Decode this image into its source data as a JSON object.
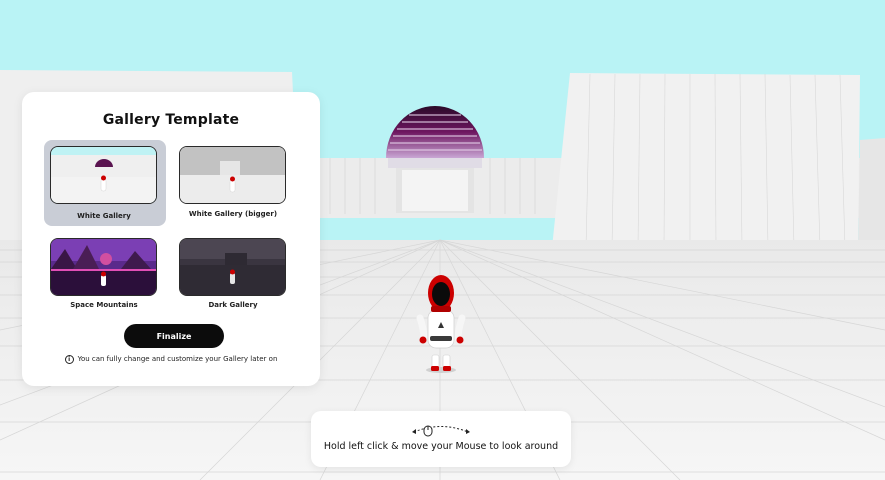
{
  "panel": {
    "title": "Gallery Template",
    "templates": [
      {
        "label": "White Gallery",
        "selected": true,
        "icon": "white-gallery-thumbnail"
      },
      {
        "label": "White Gallery (bigger)",
        "selected": false,
        "icon": "white-gallery-bigger-thumbnail"
      },
      {
        "label": "Space Mountains",
        "selected": false,
        "icon": "space-mountains-thumbnail"
      },
      {
        "label": "Dark Gallery",
        "selected": false,
        "icon": "dark-gallery-thumbnail"
      }
    ],
    "finalize_label": "Finalize",
    "hint_text": "You can fully change and customize your Gallery later on",
    "hint_icon": "info-icon"
  },
  "look_hint": {
    "text": "Hold left click & move your Mouse to look around",
    "icon": "mouse-drag-icon"
  },
  "colors": {
    "sky": "#b9f3f5",
    "floor": "#f2f2f2",
    "selected_bg": "#c9cdd6",
    "button_bg": "#0c0c0c",
    "dome_accent": "#8a1a6a",
    "suit_red": "#cc0000"
  }
}
